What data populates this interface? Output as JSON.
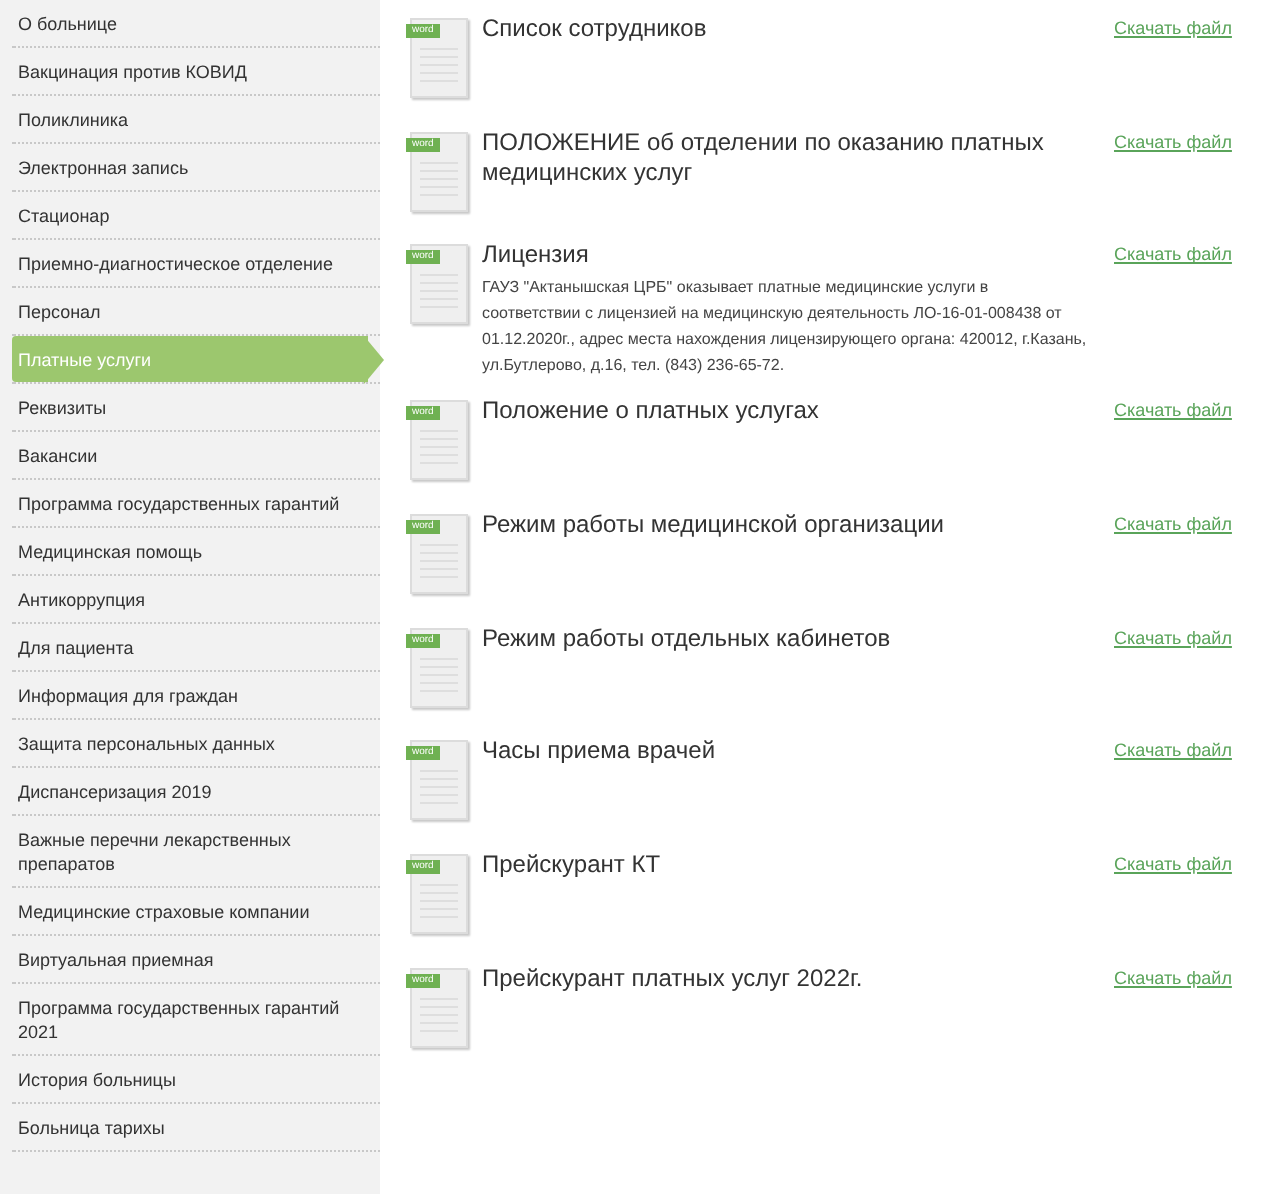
{
  "sidebar": {
    "items": [
      {
        "label": "О больнице",
        "selected": false
      },
      {
        "label": "Вакцинация против КОВИД",
        "selected": false
      },
      {
        "label": "Поликлиника",
        "selected": false
      },
      {
        "label": "Электронная запись",
        "selected": false
      },
      {
        "label": "Стационар",
        "selected": false
      },
      {
        "label": "Приемно-диагностическое отделение",
        "selected": false
      },
      {
        "label": "Персонал",
        "selected": false
      },
      {
        "label": "Платные услуги",
        "selected": true
      },
      {
        "label": "Реквизиты",
        "selected": false
      },
      {
        "label": "Вакансии",
        "selected": false
      },
      {
        "label": "Программа государственных гарантий",
        "selected": false
      },
      {
        "label": "Медицинская помощь",
        "selected": false
      },
      {
        "label": "Антикоррупция",
        "selected": false
      },
      {
        "label": "Для пациента",
        "selected": false
      },
      {
        "label": "Информация для граждан",
        "selected": false
      },
      {
        "label": "Защита персональных данных",
        "selected": false
      },
      {
        "label": "Диспансеризация 2019",
        "selected": false
      },
      {
        "label": "Важные перечни лекарственных препаратов",
        "selected": false
      },
      {
        "label": "Медицинские страховые компании",
        "selected": false
      },
      {
        "label": "Виртуальная приемная",
        "selected": false
      },
      {
        "label": "Программа государственных гарантий 2021",
        "selected": false
      },
      {
        "label": "История больницы",
        "selected": false
      },
      {
        "label": "Больница тарихы",
        "selected": false
      }
    ]
  },
  "documents": [
    {
      "badge": "word",
      "title": "Список сотрудников",
      "link": "Скачать файл"
    },
    {
      "badge": "word",
      "title": "ПОЛОЖЕНИЕ об отделении по оказанию платных медицинских услуг",
      "link": "Скачать файл"
    },
    {
      "badge": "word",
      "title": "Лицензия",
      "description": "ГАУЗ \"Актанышская ЦРБ\" оказывает платные медицинские услуги в соответствии с лицензией на медицинскую деятельность ЛО-16-01-008438 от 01.12.2020г., адрес места нахождения лицензирующего органа: 420012, г.Казань, ул.Бутлерово, д.16, тел. (843) 236-65-72.",
      "link": "Скачать файл"
    },
    {
      "badge": "word",
      "title": "Положение о платных услугах",
      "link": "Скачать файл"
    },
    {
      "badge": "word",
      "title": "Режим работы медицинской организации",
      "link": "Скачать файл"
    },
    {
      "badge": "word",
      "title": "Режим работы отдельных кабинетов",
      "link": "Скачать файл"
    },
    {
      "badge": "word",
      "title": "Часы приема врачей",
      "link": "Скачать файл"
    },
    {
      "badge": "word",
      "title": "Прейскурант КТ",
      "link": "Скачать файл"
    },
    {
      "badge": "word",
      "title": "Прейскурант платных услуг 2022г.",
      "link": "Скачать файл"
    }
  ]
}
